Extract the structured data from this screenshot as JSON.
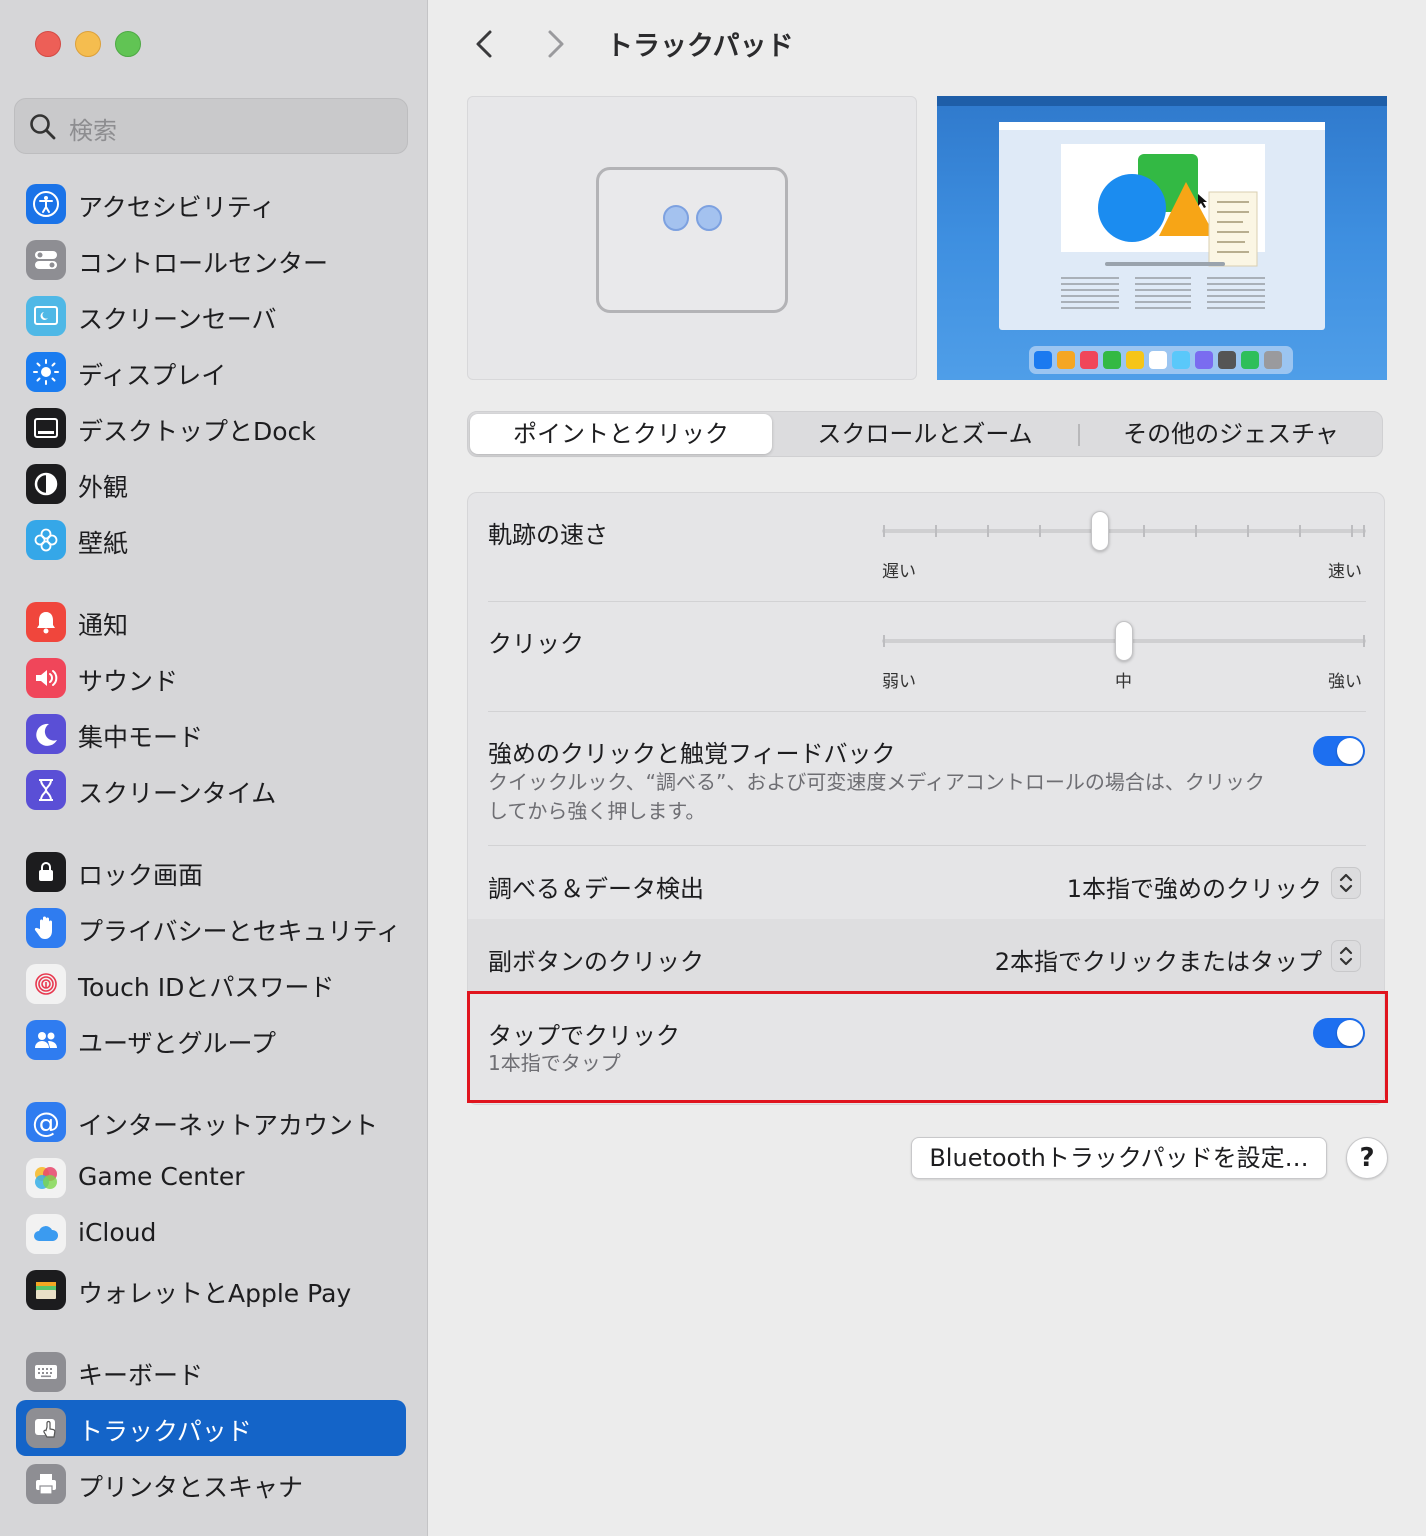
{
  "window": {
    "title": "トラックパッド"
  },
  "search": {
    "placeholder": "検索"
  },
  "sidebar": {
    "items": [
      {
        "label": "アクセシビリティ",
        "icon": "accessibility-icon",
        "color": "#1a73e8"
      },
      {
        "label": "コントロールセンター",
        "icon": "control-center-icon",
        "color": "#8e8e93"
      },
      {
        "label": "スクリーンセーバ",
        "icon": "screensaver-icon",
        "color": "#4fb8e6"
      },
      {
        "label": "ディスプレイ",
        "icon": "display-icon",
        "color": "#1a7cf0"
      },
      {
        "label": "デスクトップとDock",
        "icon": "desktop-dock-icon",
        "color": "#1c1c1e"
      },
      {
        "label": "外観",
        "icon": "appearance-icon",
        "color": "#1c1c1e"
      },
      {
        "label": "壁紙",
        "icon": "wallpaper-icon",
        "color": "#35a7e8"
      },
      {
        "label": "通知",
        "icon": "notifications-icon",
        "color": "#f0463c"
      },
      {
        "label": "サウンド",
        "icon": "sound-icon",
        "color": "#f0465a"
      },
      {
        "label": "集中モード",
        "icon": "focus-icon",
        "color": "#5a4fd6"
      },
      {
        "label": "スクリーンタイム",
        "icon": "screen-time-icon",
        "color": "#5a4fd6"
      },
      {
        "label": "ロック画面",
        "icon": "lock-screen-icon",
        "color": "#1c1c1e"
      },
      {
        "label": "プライバシーとセキュリティ",
        "icon": "privacy-hand-icon",
        "color": "#2f7cf0"
      },
      {
        "label": "Touch IDとパスワード",
        "icon": "fingerprint-icon",
        "color": "#f2f2f2"
      },
      {
        "label": "ユーザとグループ",
        "icon": "users-icon",
        "color": "#2f7cf0"
      },
      {
        "label": "インターネットアカウント",
        "icon": "at-icon",
        "color": "#2f7cf0"
      },
      {
        "label": "Game Center",
        "icon": "game-center-icon",
        "color": "#f2f2f2"
      },
      {
        "label": "iCloud",
        "icon": "icloud-icon",
        "color": "#f2f2f2"
      },
      {
        "label": "ウォレットとApple Pay",
        "icon": "wallet-icon",
        "color": "#1c1c1e"
      },
      {
        "label": "キーボード",
        "icon": "keyboard-icon",
        "color": "#8e8e93"
      },
      {
        "label": "トラックパッド",
        "icon": "trackpad-icon",
        "color": "#8e8e93"
      },
      {
        "label": "プリンタとスキャナ",
        "icon": "printer-icon",
        "color": "#8e8e93"
      }
    ]
  },
  "tabs": [
    {
      "label": "ポイントとクリック"
    },
    {
      "label": "スクロールとズーム"
    },
    {
      "label": "その他のジェスチャ"
    }
  ],
  "settings": {
    "tracking_speed": {
      "label": "軌跡の速さ",
      "min_label": "遅い",
      "max_label": "速い",
      "value": 0.45
    },
    "click": {
      "label": "クリック",
      "min_label": "弱い",
      "mid_label": "中",
      "max_label": "強い",
      "value": 0.5
    },
    "force_click": {
      "label": "強めのクリックと触覚フィードバック",
      "desc_line1": "クイックルック、“調べる”、および可変速度メディアコントロールの場合は、クリック",
      "desc_line2": "してから強く押します。",
      "enabled": true
    },
    "lookup": {
      "label": "調べる＆データ検出",
      "value": "1本指で強めのクリック"
    },
    "secondary_click": {
      "label": "副ボタンのクリック",
      "value": "2本指でクリックまたはタップ"
    },
    "tap_to_click": {
      "label": "タップでクリック",
      "sub": "1本指でタップ",
      "enabled": true
    }
  },
  "buttons": {
    "bluetooth": "Bluetoothトラックパッドを設定…",
    "help": "?"
  }
}
